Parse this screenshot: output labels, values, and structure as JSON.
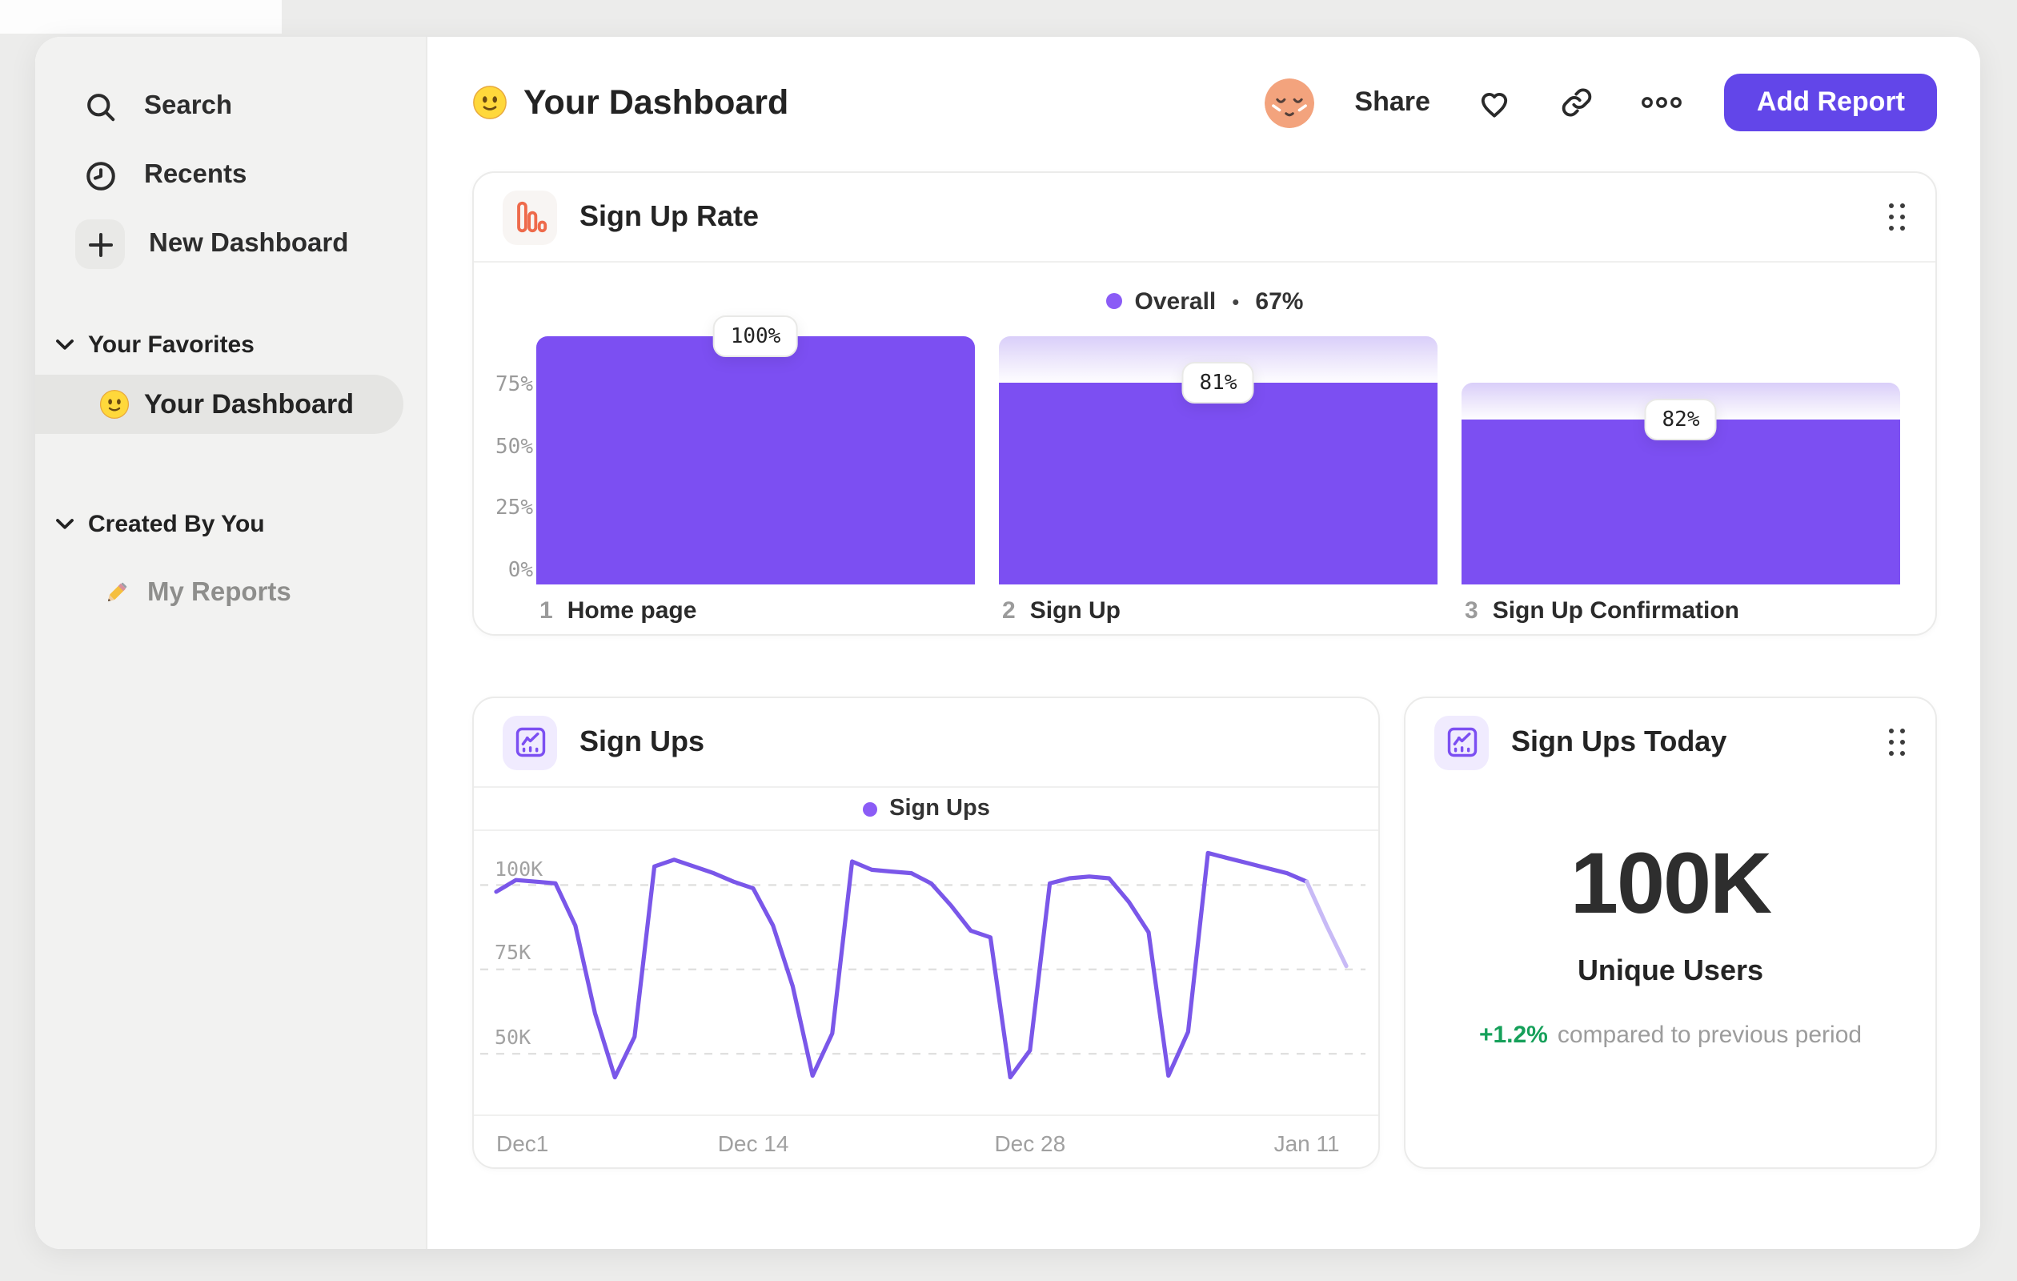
{
  "header": {
    "title": "Your Dashboard",
    "share_label": "Share",
    "add_report_label": "Add Report"
  },
  "sidebar": {
    "items": [
      {
        "label": "Search",
        "icon": "search-icon"
      },
      {
        "label": "Recents",
        "icon": "clock-icon"
      },
      {
        "label": "New Dashboard",
        "icon": "plus-icon"
      }
    ],
    "sections": [
      {
        "label": "Your Favorites",
        "items": [
          {
            "label": "Your Dashboard",
            "icon": "smiley-emoji",
            "selected": true
          }
        ]
      },
      {
        "label": "Created By You",
        "items": [
          {
            "label": "My Reports",
            "icon": "pencil-emoji",
            "selected": false
          }
        ]
      }
    ]
  },
  "cards": {
    "sign_up_rate": {
      "title": "Sign Up Rate",
      "legend": {
        "label": "Overall",
        "separator": "•",
        "value": "67%"
      },
      "ylabels": [
        "75%",
        "50%",
        "25%",
        "0%"
      ],
      "steps": [
        {
          "num": "1",
          "label": "Home page",
          "badge": "100%"
        },
        {
          "num": "2",
          "label": "Sign Up",
          "badge": "81%"
        },
        {
          "num": "3",
          "label": "Sign Up Confirmation",
          "badge": "82%"
        }
      ]
    },
    "sign_ups": {
      "title": "Sign Ups",
      "legend": "Sign Ups",
      "y_ticks": [
        "100K",
        "75K",
        "50K"
      ],
      "x_ticks": [
        "Dec1",
        "Dec 14",
        "Dec 28",
        "Jan 11"
      ]
    },
    "sign_ups_today": {
      "title": "Sign Ups Today",
      "value": "100K",
      "subtitle": "Unique Users",
      "delta": "+1.2%",
      "delta_caption": "compared to previous period"
    }
  },
  "colors": {
    "accent_purple": "#7C4FF2",
    "legend_dot": "#8B5CF6",
    "button": "#6246E9",
    "orange_icon": "#EE6A4B",
    "green_delta": "#16A05A",
    "line": "#7A57E9",
    "line_faded": "#C8BAF6"
  },
  "chart_data": [
    {
      "type": "bar",
      "title": "Sign Up Rate",
      "legend": [
        {
          "name": "Overall",
          "value_pct": 67
        }
      ],
      "categories": [
        "Home page",
        "Sign Up",
        "Sign Up Confirmation"
      ],
      "values": [
        100,
        81,
        82
      ],
      "absolute_pct": [
        100,
        81,
        66.4
      ],
      "prev_pct": [
        100,
        100,
        81
      ],
      "ylabel_values": [
        75,
        50,
        25,
        0
      ],
      "ylim": [
        0,
        100
      ],
      "note": "values are per-step conversion %, absolute_pct is solid bar height, prev_pct is gradient top (previous step level)"
    },
    {
      "type": "line",
      "title": "Sign Ups",
      "series": [
        {
          "name": "Sign Ups",
          "values_k": [
            98,
            101.5,
            101,
            100.5,
            88,
            62,
            43,
            55,
            105.5,
            107.5,
            105.5,
            103.5,
            101,
            99,
            88,
            70,
            43.5,
            56,
            107,
            104.5,
            104,
            103.5,
            100.5,
            94,
            86.5,
            84.5,
            43,
            51,
            100.5,
            102,
            102.5,
            102,
            95,
            86,
            43.5,
            56.5,
            109.5,
            108,
            106.5,
            105,
            103.5,
            101,
            88,
            76
          ]
        }
      ],
      "x_tick_labels": [
        "Dec1",
        "Dec 14",
        "Dec 28",
        "Jan 11"
      ],
      "x_tick_indices": [
        0,
        13,
        27,
        41
      ],
      "faded_from_index": 41,
      "y_grid_values": [
        100,
        75,
        50
      ],
      "y_tick_labels": [
        "100K",
        "75K",
        "50K"
      ],
      "ylim_k": [
        32,
        116
      ],
      "grid": "dashed horizontal"
    }
  ]
}
